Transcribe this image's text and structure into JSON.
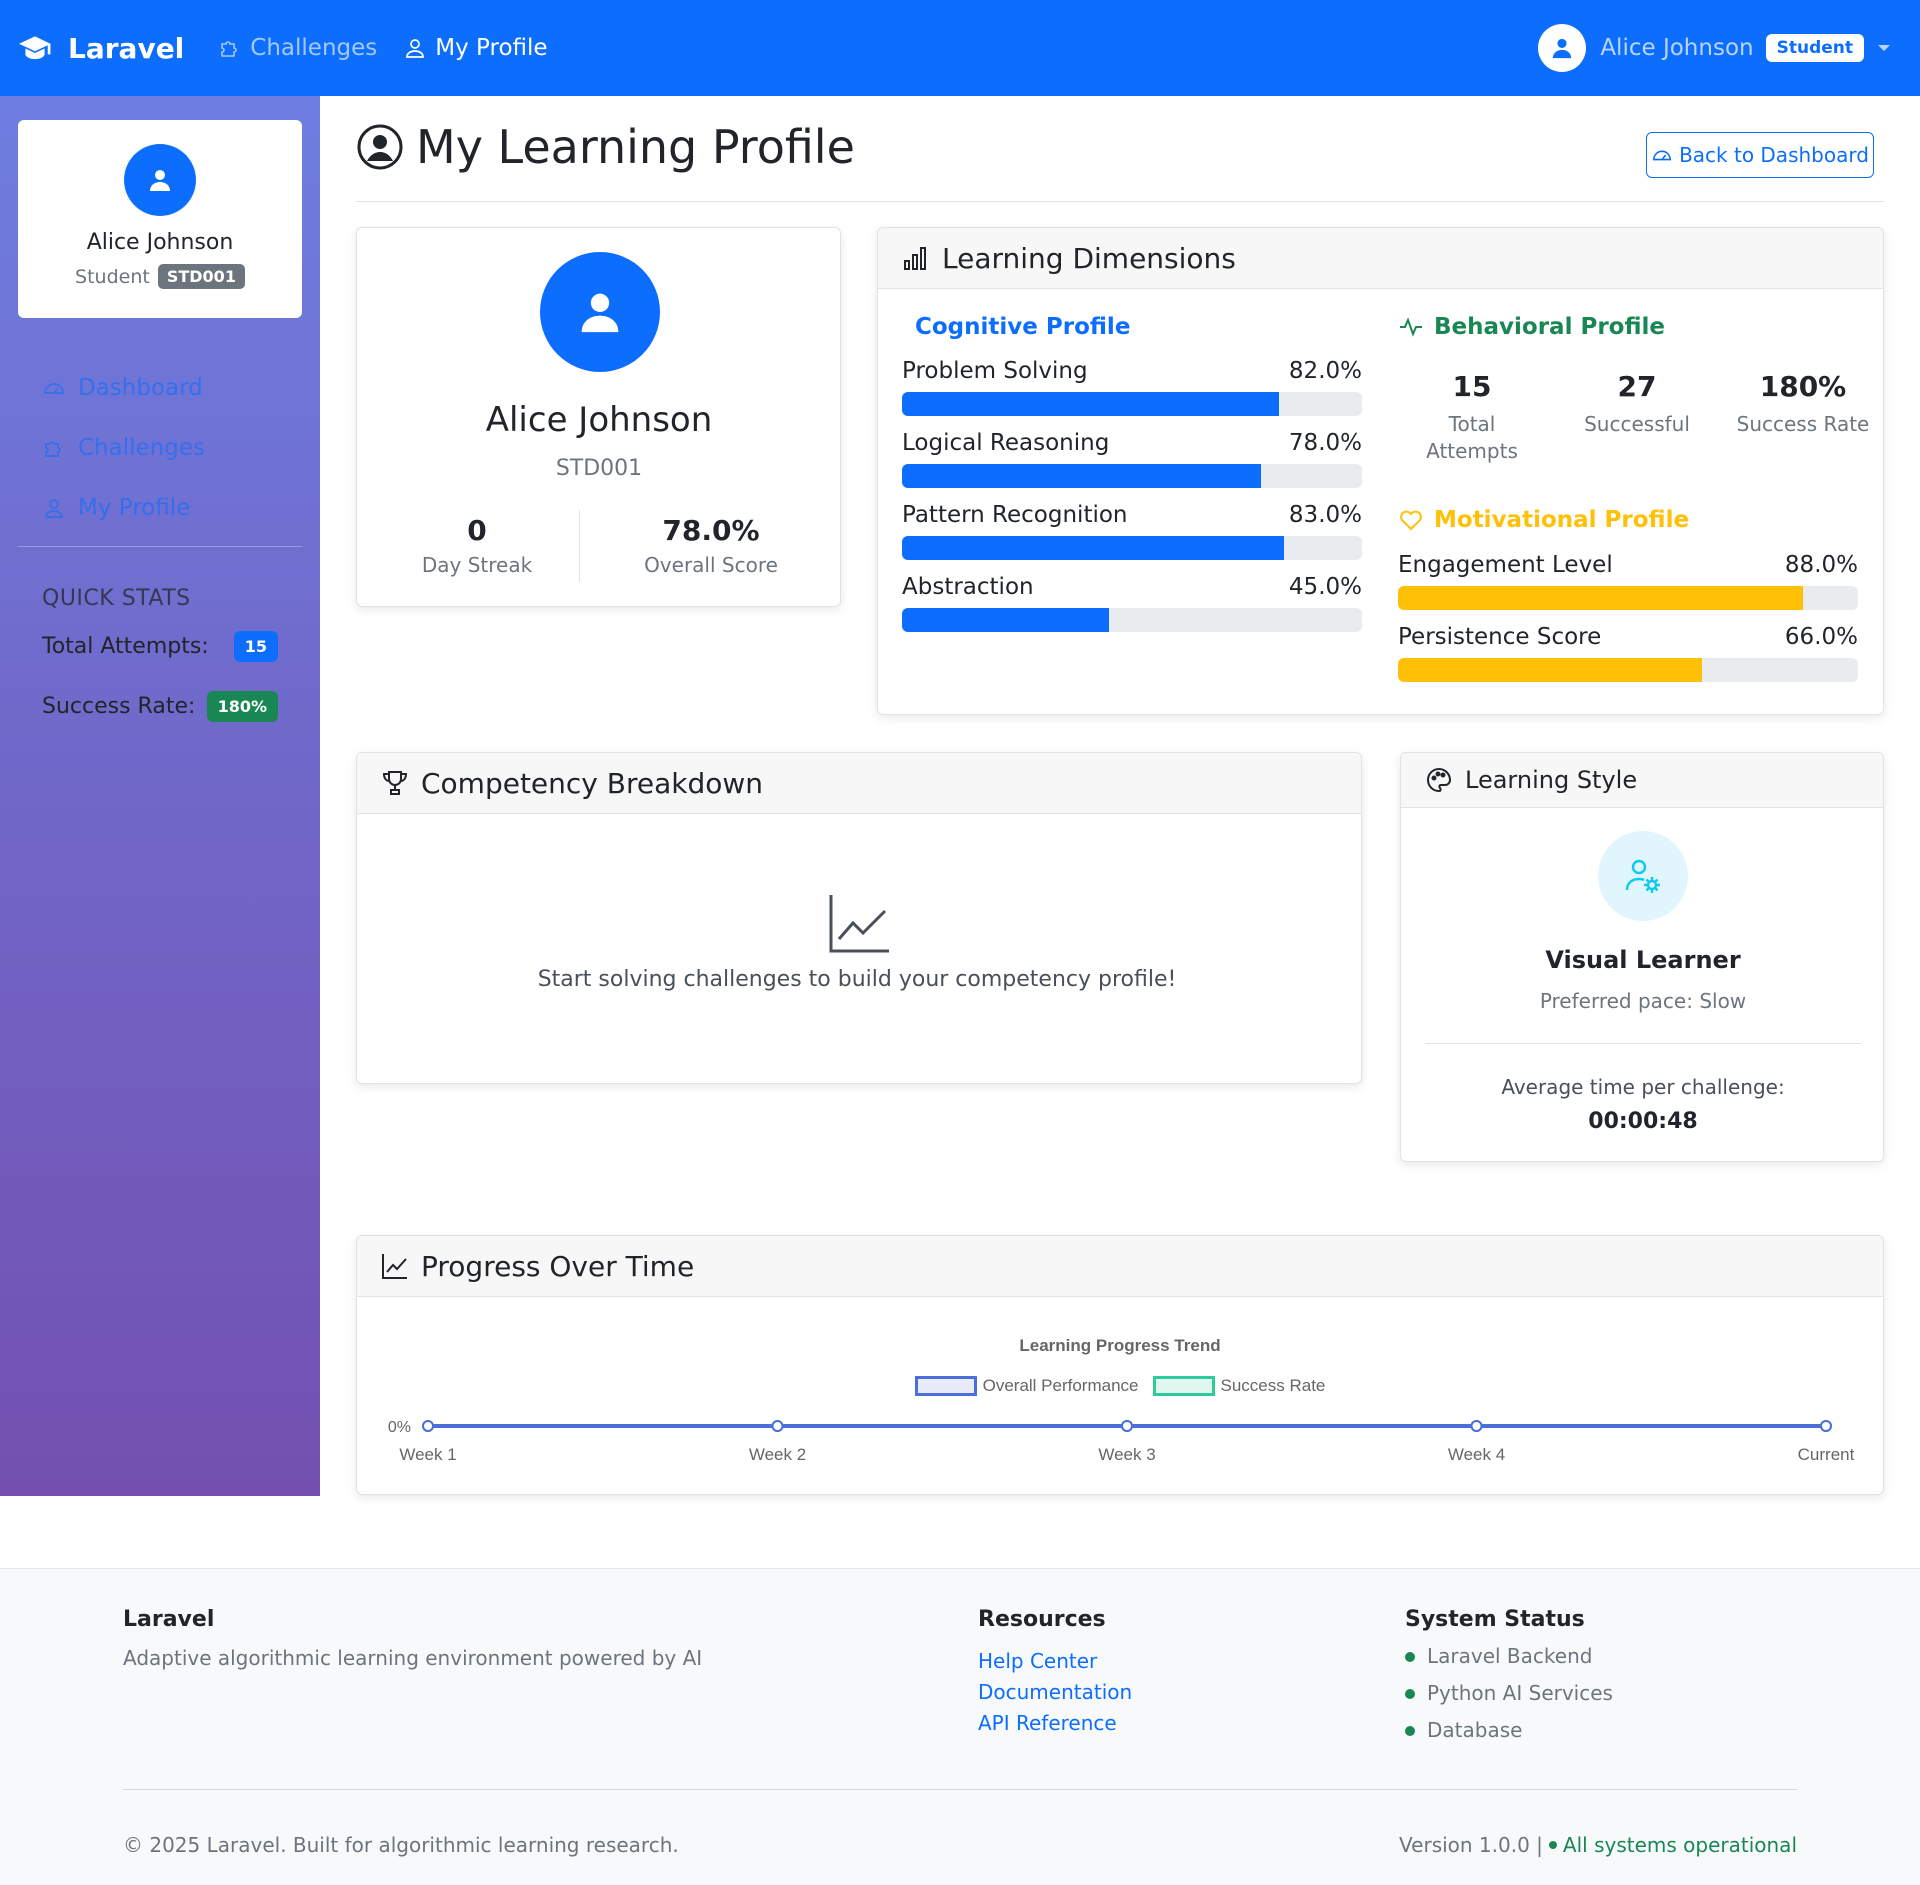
{
  "navbar": {
    "brand": "Laravel",
    "links": [
      {
        "label": "Challenges",
        "icon": "puzzle-icon"
      },
      {
        "label": "My Profile",
        "icon": "person-icon"
      }
    ],
    "user_name": "Alice Johnson",
    "role_badge": "Student"
  },
  "sidebar": {
    "name": "Alice Johnson",
    "role": "Student",
    "student_id": "STD001",
    "nav": [
      {
        "label": "Dashboard",
        "icon": "speedometer-icon"
      },
      {
        "label": "Challenges",
        "icon": "puzzle-icon"
      },
      {
        "label": "My Profile",
        "icon": "person-icon"
      }
    ],
    "quick_stats_title": "QUICK STATS",
    "quick_stats": [
      {
        "label": "Total Attempts:",
        "value": "15",
        "color": "#0d6efd"
      },
      {
        "label": "Success Rate:",
        "value": "180%",
        "color": "#198754"
      }
    ]
  },
  "page": {
    "title": "My Learning Profile",
    "back_button": "Back to Dashboard"
  },
  "profile_card": {
    "name": "Alice Johnson",
    "student_id": "STD001",
    "streak_value": "0",
    "streak_label": "Day Streak",
    "score_value": "78.0%",
    "score_label": "Overall Score"
  },
  "learning_dimensions": {
    "title": "Learning Dimensions",
    "cognitive": {
      "title": "Cognitive Profile",
      "color": "#0d6efd",
      "metrics": [
        {
          "label": "Problem Solving",
          "value": "82.0%",
          "fraction": 0.82
        },
        {
          "label": "Logical Reasoning",
          "value": "78.0%",
          "fraction": 0.78
        },
        {
          "label": "Pattern Recognition",
          "value": "83.0%",
          "fraction": 0.83
        },
        {
          "label": "Abstraction",
          "value": "45.0%",
          "fraction": 0.45
        }
      ]
    },
    "behavioral": {
      "title": "Behavioral Profile",
      "color": "#198754",
      "stats": [
        {
          "value": "15",
          "label": "Total Attempts"
        },
        {
          "value": "27",
          "label": "Successful"
        },
        {
          "value": "180%",
          "label": "Success Rate"
        }
      ]
    },
    "motivational": {
      "title": "Motivational Profile",
      "color": "#ffc107",
      "metrics": [
        {
          "label": "Engagement Level",
          "value": "88.0%",
          "fraction": 0.88
        },
        {
          "label": "Persistence Score",
          "value": "66.0%",
          "fraction": 0.66
        }
      ]
    }
  },
  "competency": {
    "title": "Competency Breakdown",
    "empty_text": "Start solving challenges to build your competency profile!"
  },
  "learning_style": {
    "title": "Learning Style",
    "style": "Visual Learner",
    "pace": "Preferred pace: Slow",
    "avg_label": "Average time per challenge:",
    "avg_value": "00:00:48"
  },
  "progress": {
    "title": "Progress Over Time"
  },
  "chart_data": {
    "type": "line",
    "title": "Learning Progress Trend",
    "categories": [
      "Week 1",
      "Week 2",
      "Week 3",
      "Week 4",
      "Current"
    ],
    "series": [
      {
        "name": "Overall Performance",
        "values": [
          0,
          0,
          0,
          0,
          0
        ],
        "color": "#4c6ed8"
      },
      {
        "name": "Success Rate",
        "values": [
          0,
          0,
          0,
          0,
          0
        ],
        "color": "#2ecc9a"
      }
    ],
    "y_tick_labels": [
      "0%"
    ],
    "legend_position": "top"
  },
  "footer": {
    "brand": "Laravel",
    "tagline": "Adaptive algorithmic learning environment powered by AI",
    "resources_title": "Resources",
    "resources": [
      "Help Center",
      "Documentation",
      "API Reference"
    ],
    "status_title": "System Status",
    "statuses": [
      "Laravel Backend",
      "Python AI Services",
      "Database"
    ],
    "copyright": "© 2025 Laravel. Built for algorithmic learning research.",
    "version": "Version 1.0.0 |",
    "operational": "All systems operational"
  }
}
